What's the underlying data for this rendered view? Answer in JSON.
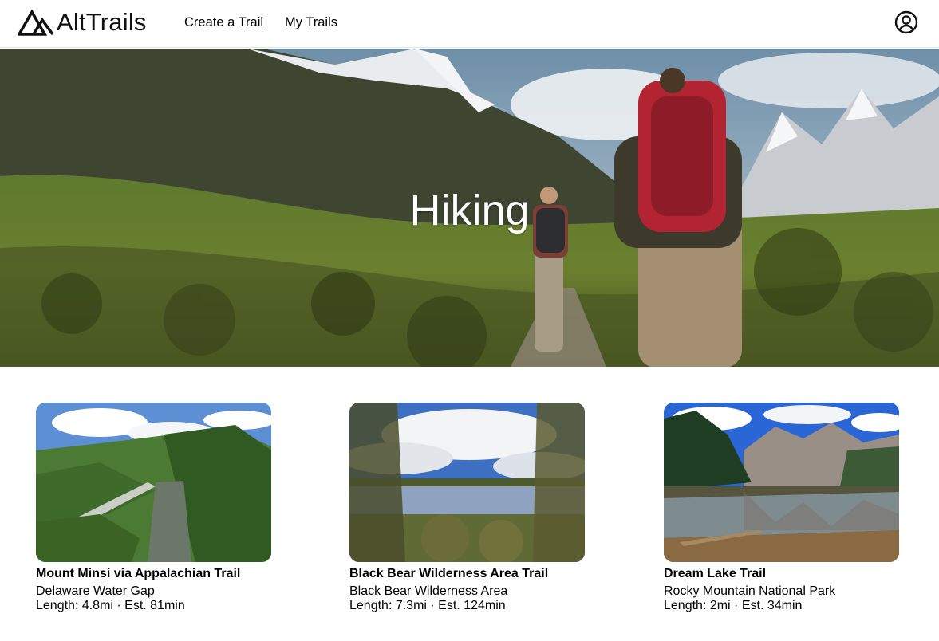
{
  "header": {
    "brand": "AltTrails",
    "logo_icon": "mountain-logo-icon",
    "nav": [
      {
        "label": "Create a Trail"
      },
      {
        "label": "My Trails"
      }
    ],
    "account_icon": "user-circle-icon"
  },
  "hero": {
    "title": "Hiking"
  },
  "trails": [
    {
      "name": "Mount Minsi via Appalachian Trail",
      "park": "Delaware Water Gap",
      "meta": "Length: 4.8mi · Est. 81min"
    },
    {
      "name": "Black Bear Wilderness Area Trail",
      "park": "Black Bear Wilderness Area",
      "meta": "Length: 7.3mi · Est. 124min"
    },
    {
      "name": "Dream Lake Trail",
      "park": "Rocky Mountain National Park",
      "meta": "Length: 2mi · Est. 34min"
    }
  ]
}
